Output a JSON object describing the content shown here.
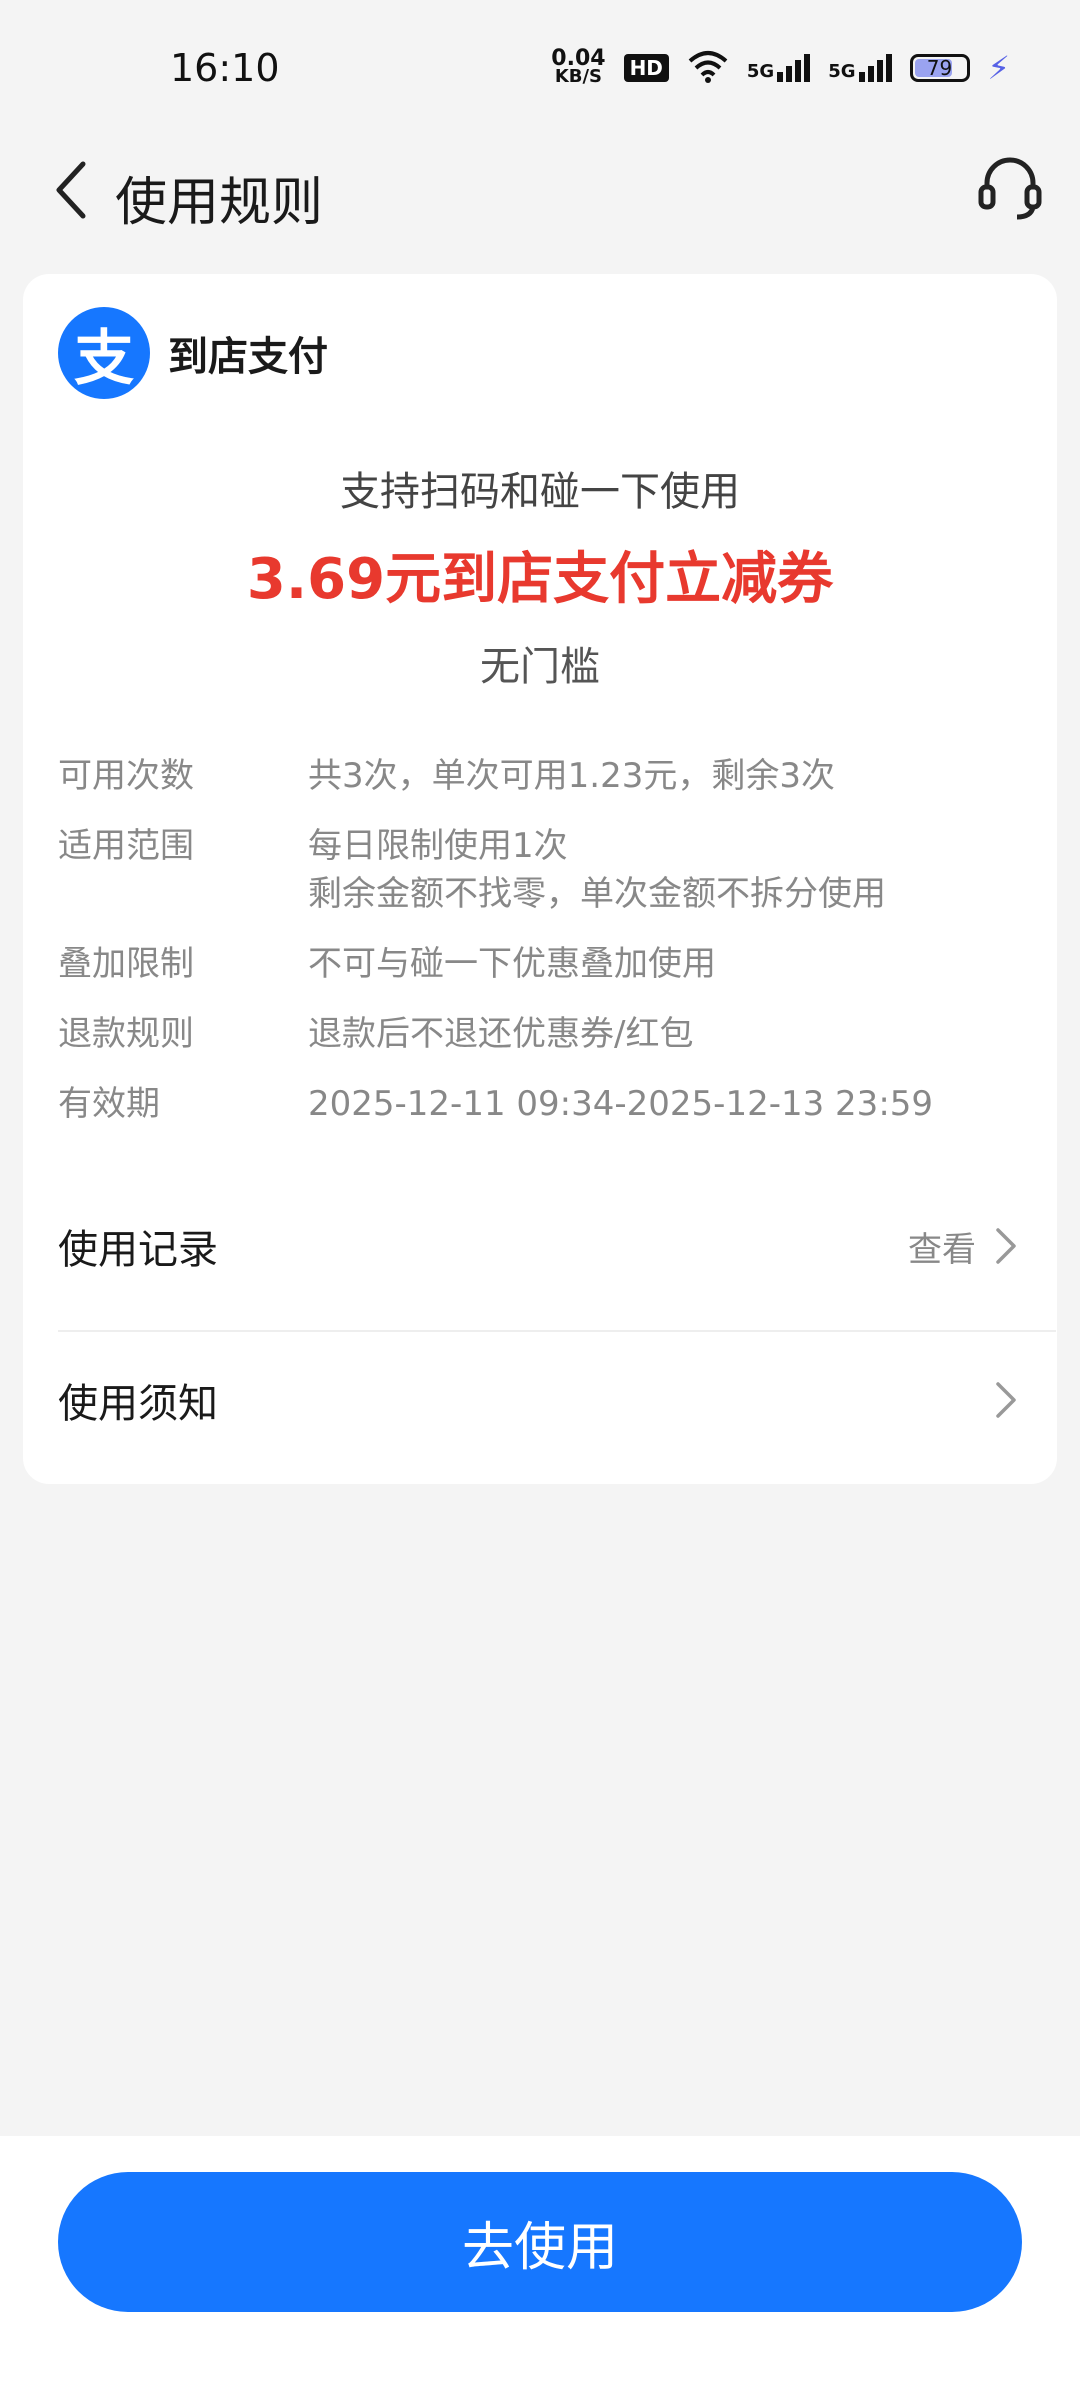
{
  "status_bar": {
    "time": "16:10",
    "net_speed_value": "0.04",
    "net_speed_unit": "KB/S",
    "hd_badge": "HD",
    "signal_1": "5G",
    "signal_2": "5G",
    "battery": "79"
  },
  "header": {
    "title": "使用规则",
    "back_icon": "chevron-left-icon",
    "support_icon": "headset-icon"
  },
  "card": {
    "brand": {
      "logo_glyph": "支",
      "name": "到店支付"
    },
    "support_line": "支持扫码和碰一下使用",
    "coupon_title": "3.69元到店支付立减券",
    "threshold": "无门槛",
    "rules": [
      {
        "key": "可用次数",
        "value": "共3次，单次可用1.23元，剩余3次"
      },
      {
        "key": "适用范围",
        "value": "每日限制使用1次",
        "value2": "剩余金额不找零，单次金额不拆分使用"
      },
      {
        "key": "叠加限制",
        "value": "不可与碰一下优惠叠加使用"
      },
      {
        "key": "退款规则",
        "value": "退款后不退还优惠券/红包"
      },
      {
        "key": "有效期",
        "value": "2025-12-11 09:34-2025-12-13 23:59"
      }
    ],
    "usage_record": {
      "label": "使用记录",
      "action": "查看"
    },
    "usage_notice": {
      "label": "使用须知"
    }
  },
  "cta": {
    "label": "去使用"
  },
  "colors": {
    "accent": "#1677ff",
    "price_red": "#e8392e",
    "background": "#f4f4f4"
  }
}
